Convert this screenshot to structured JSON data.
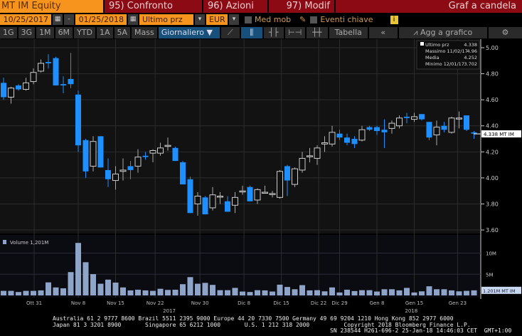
{
  "header": {
    "security": "MT IM Equity",
    "btn95": "95) Confronto",
    "btn96": "96) Azioni",
    "btn97": "97) Modif",
    "chart_type": "Graf a candela"
  },
  "controls": {
    "start_date": "10/25/2017",
    "dash": "-",
    "end_date": "01/25/2018",
    "field": "Ultimo prz",
    "currency": "EUR",
    "med_mob": "Med mob",
    "eventi": "Eventi chiave",
    "info": "i"
  },
  "toolbar": {
    "periods": [
      "1G",
      "3G",
      "1M",
      "6M",
      "YTD",
      "1A",
      "5A",
      "Mass"
    ],
    "frequency": "Giornaliero ▼",
    "tabella": "Tabella",
    "collapse": "«",
    "agg": "Agg a grafico",
    "settings": "⚙"
  },
  "legend": {
    "last_label": "Ultimo prz",
    "last_val": "4.338",
    "max_label": "Massimo 11/02/17",
    "max_val": "4.96",
    "avg_label": "Media",
    "avg_val": "4.252",
    "min_label": "Minimo 12/01/17",
    "min_val": "3.702"
  },
  "last_tag": "4.338 MT IM",
  "volume_legend": "Volume 1,201M",
  "volume_tag": "1.201M MT IM",
  "colors": {
    "up": "#cccccc",
    "down": "#1e8fff",
    "volume": "#8ea4c8"
  },
  "chart_data": {
    "type": "candlestick",
    "ylim": [
      3.6,
      5.0
    ],
    "yticks": [
      "3.60",
      "3.80",
      "4.00",
      "4.20",
      "4.40",
      "4.60",
      "4.80",
      "5.00"
    ],
    "vticks": [
      {
        "v": 5,
        "label": "5M"
      },
      {
        "v": 10,
        "label": "10M"
      }
    ],
    "xlabels": [
      {
        "i": 4.1,
        "t": "Ott 31"
      },
      {
        "i": 10,
        "t": "Nov 8"
      },
      {
        "i": 15,
        "t": "Nov 15"
      },
      {
        "i": 20.3,
        "t": "Nov 22"
      },
      {
        "i": 26.3,
        "t": "Nov 30"
      },
      {
        "i": 32.2,
        "t": "Dic 8"
      },
      {
        "i": 37.2,
        "t": "Dic 15"
      },
      {
        "i": 42.2,
        "t": "Dic 22"
      },
      {
        "i": 45,
        "t": "Dic 29"
      },
      {
        "i": 50,
        "t": "Gen 8"
      },
      {
        "i": 55,
        "t": "Gen 15"
      },
      {
        "i": 60.8,
        "t": "Gen 23"
      }
    ],
    "years": [
      {
        "i": 22.2,
        "t": "2017"
      },
      {
        "i": 54.6,
        "t": "2018"
      }
    ],
    "ohlc": [
      [
        4.73,
        4.77,
        4.6,
        4.62
      ],
      [
        4.62,
        4.7,
        4.57,
        4.69
      ],
      [
        4.71,
        4.72,
        4.67,
        4.68
      ],
      [
        4.68,
        4.77,
        4.67,
        4.73
      ],
      [
        4.74,
        4.84,
        4.72,
        4.81
      ],
      [
        4.82,
        4.91,
        4.81,
        4.88
      ],
      [
        4.89,
        4.95,
        4.84,
        4.88
      ],
      [
        4.92,
        4.93,
        4.71,
        4.71
      ],
      [
        4.72,
        4.78,
        4.65,
        4.71
      ],
      [
        4.76,
        4.96,
        4.69,
        4.72
      ],
      [
        4.64,
        4.67,
        4.2,
        4.25
      ],
      [
        4.29,
        4.3,
        4.0,
        4.05
      ],
      [
        4.09,
        4.32,
        4.05,
        4.28
      ],
      [
        4.32,
        4.32,
        4.08,
        4.08
      ],
      [
        4.06,
        4.15,
        3.93,
        3.99
      ],
      [
        3.98,
        4.09,
        3.91,
        4.03
      ],
      [
        4.05,
        4.15,
        3.98,
        4.06
      ],
      [
        4.09,
        4.13,
        3.99,
        4.06
      ],
      [
        4.09,
        4.22,
        4.04,
        4.16
      ],
      [
        4.17,
        4.2,
        4.14,
        4.16
      ],
      [
        4.19,
        4.22,
        4.12,
        4.21
      ],
      [
        4.19,
        4.27,
        4.17,
        4.23
      ],
      [
        4.25,
        4.31,
        4.21,
        4.25
      ],
      [
        4.23,
        4.24,
        4.13,
        4.13
      ],
      [
        4.12,
        4.13,
        3.95,
        3.95
      ],
      [
        3.99,
        4.01,
        3.73,
        3.73
      ],
      [
        3.8,
        3.89,
        3.71,
        3.86
      ],
      [
        3.85,
        3.86,
        3.72,
        3.72
      ],
      [
        3.77,
        3.93,
        3.75,
        3.87
      ],
      [
        3.86,
        3.89,
        3.8,
        3.86
      ],
      [
        3.82,
        3.86,
        3.74,
        3.74
      ],
      [
        3.79,
        3.89,
        3.73,
        3.85
      ],
      [
        3.9,
        3.94,
        3.87,
        3.9
      ],
      [
        3.93,
        3.94,
        3.82,
        3.82
      ],
      [
        3.83,
        3.92,
        3.8,
        3.91
      ],
      [
        3.89,
        3.94,
        3.88,
        3.89
      ],
      [
        3.88,
        3.9,
        3.85,
        3.88
      ],
      [
        3.85,
        4.06,
        3.84,
        4.05
      ],
      [
        4.09,
        4.1,
        3.86,
        3.98
      ],
      [
        3.95,
        4.08,
        3.93,
        4.07
      ],
      [
        4.06,
        4.2,
        4.04,
        4.15
      ],
      [
        4.17,
        4.23,
        4.12,
        4.17
      ],
      [
        4.15,
        4.25,
        4.1,
        4.23
      ],
      [
        4.26,
        4.32,
        4.2,
        4.27
      ],
      [
        4.26,
        4.4,
        4.24,
        4.35
      ],
      [
        4.34,
        4.37,
        4.29,
        4.31
      ],
      [
        4.31,
        4.34,
        4.25,
        4.27
      ],
      [
        4.3,
        4.32,
        4.23,
        4.26
      ],
      [
        4.29,
        4.4,
        4.28,
        4.37
      ],
      [
        4.39,
        4.4,
        4.36,
        4.37
      ],
      [
        4.39,
        4.4,
        4.33,
        4.36
      ],
      [
        4.37,
        4.45,
        4.23,
        4.35
      ],
      [
        4.38,
        4.44,
        4.34,
        4.42
      ],
      [
        4.4,
        4.48,
        4.38,
        4.46
      ],
      [
        4.47,
        4.5,
        4.42,
        4.46
      ],
      [
        4.45,
        4.5,
        4.43,
        4.47
      ],
      [
        4.49,
        4.49,
        4.44,
        4.45
      ],
      [
        4.43,
        4.43,
        4.29,
        4.31
      ],
      [
        4.33,
        4.44,
        4.25,
        4.39
      ],
      [
        4.4,
        4.43,
        4.35,
        4.37
      ],
      [
        4.35,
        4.47,
        4.34,
        4.46
      ],
      [
        4.46,
        4.51,
        4.38,
        4.46
      ],
      [
        4.48,
        4.48,
        4.36,
        4.37
      ],
      [
        4.35,
        4.36,
        4.3,
        4.34
      ]
    ],
    "volume_m": [
      1.08,
      1.08,
      0.81,
      1.08,
      1.08,
      1.19,
      3.08,
      1.89,
      1.68,
      5.51,
      12.4,
      7.84,
      5.03,
      2.76,
      3.73,
      3.03,
      1.89,
      1.19,
      1.35,
      1.19,
      1.08,
      1.57,
      1.3,
      1.35,
      2.65,
      4.32,
      2.76,
      2.97,
      2.49,
      1.24,
      1.24,
      1.78,
      0.92,
      0.81,
      1.24,
      1.19,
      0.92,
      2.54,
      2.0,
      1.46,
      2.43,
      1.19,
      1.24,
      0.97,
      1.89,
      0.7,
      1.35,
      1.03,
      1.24,
      1.24,
      0.92,
      1.46,
      1.46,
      1.19,
      1.78,
      0.7,
      0.97,
      2.16,
      1.46,
      1.46,
      1.19,
      0.97,
      1.08,
      1.2
    ]
  },
  "footer": {
    "line1": "Australia 61 2 9777 8600 Brazil 5511 2395 9000 Europe 44 20 7330 7500 Germany 49 69 9204 1210 Hong Kong 852 2977 6000",
    "line2": "Japan 81 3 3201 8900       Singapore 65 6212 1000       U.S. 1 212 318 2000          Copyright 2018 Bloomberg Finance L.P.",
    "line3": "SN 238544 H261-696-2 25-Jan-18 14:46:03 CET  GMT+1:00"
  }
}
